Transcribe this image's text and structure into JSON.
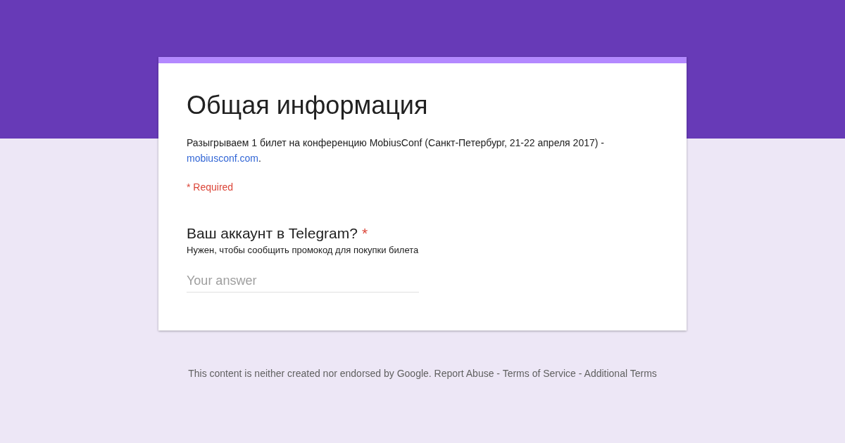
{
  "form": {
    "title": "Общая информация",
    "description": {
      "text": "Разыгрываем 1 билет на конференцию MobiusConf (Санкт-Петербург, 21-22 апреля 2017) - ",
      "link": "mobiusconf.com",
      "suffix": "."
    },
    "required_note": "* Required",
    "questions": [
      {
        "title": "Ваш аккаунт в Telegram?",
        "required": true,
        "required_mark": "*",
        "help": "Нужен, чтобы сообщить промокод для покупки билета",
        "placeholder": "Your answer"
      }
    ]
  },
  "footer": "This content is neither created nor endorsed by Google. Report Abuse - Terms of Service - Additional Terms"
}
